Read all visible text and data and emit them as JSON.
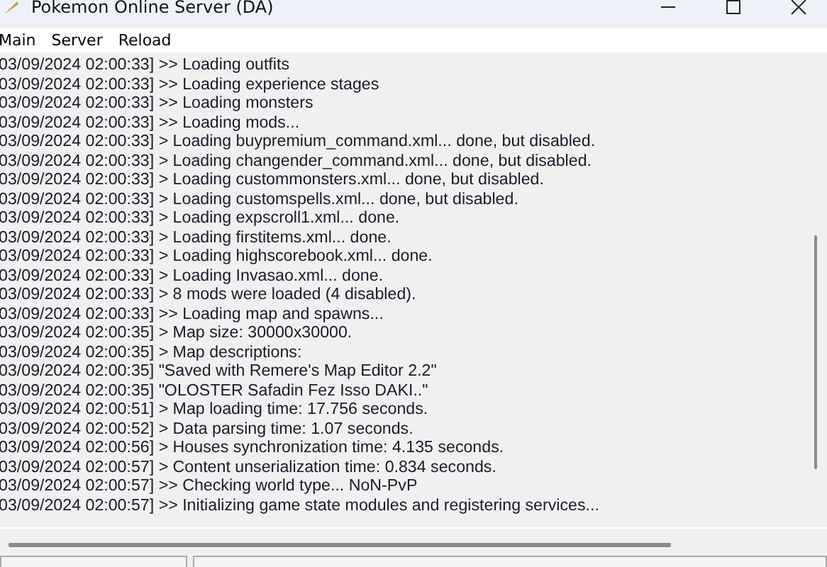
{
  "window": {
    "title": "Pokemon Online Server (DA)"
  },
  "menu": [
    "Main",
    "Server",
    "Reload"
  ],
  "log": [
    "03/09/2024 02:00:33] >> Loading outfits",
    "03/09/2024 02:00:33] >> Loading experience stages",
    "03/09/2024 02:00:33] >> Loading monsters",
    "03/09/2024 02:00:33] >> Loading mods...",
    "03/09/2024 02:00:33] > Loading buypremium_command.xml... done, but disabled.",
    "03/09/2024 02:00:33] > Loading changender_command.xml... done, but disabled.",
    "03/09/2024 02:00:33] > Loading custommonsters.xml... done, but disabled.",
    "03/09/2024 02:00:33] > Loading customspells.xml... done, but disabled.",
    "03/09/2024 02:00:33] > Loading expscroll1.xml... done.",
    "03/09/2024 02:00:33] > Loading firstitems.xml... done.",
    "03/09/2024 02:00:33] > Loading highscorebook.xml... done.",
    "03/09/2024 02:00:33] > Loading Invasao.xml... done.",
    "03/09/2024 02:00:33] > 8 mods were loaded (4 disabled).",
    "03/09/2024 02:00:33] >> Loading map and spawns...",
    "03/09/2024 02:00:35] > Map size: 30000x30000.",
    "03/09/2024 02:00:35] > Map descriptions:",
    "03/09/2024 02:00:35] \"Saved with Remere's Map Editor 2.2\"",
    "03/09/2024 02:00:35] \"OLOSTER Safadin Fez Isso DAKI..\"",
    "03/09/2024 02:00:51] > Map loading time: 17.756 seconds.",
    "03/09/2024 02:00:52] > Data parsing time: 1.07 seconds.",
    "03/09/2024 02:00:56] > Houses synchronization time: 4.135 seconds.",
    "03/09/2024 02:00:57] > Content unserialization time: 0.834 seconds.",
    "03/09/2024 02:00:57] >> Checking world type... NoN-PvP",
    "03/09/2024 02:00:57] >> Initializing game state modules and registering services..."
  ]
}
